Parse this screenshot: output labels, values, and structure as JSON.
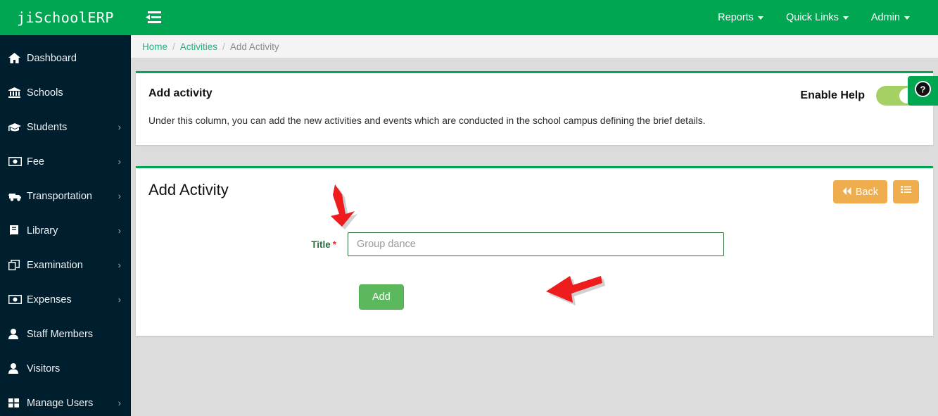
{
  "header": {
    "brand": "jiSchoolERP",
    "sidebar_toggle_icon": "sidebar-collapse-icon",
    "nav": [
      {
        "label": "Reports",
        "icon": "chevron-down-icon"
      },
      {
        "label": "Quick Links",
        "icon": "chevron-down-icon"
      },
      {
        "label": "Admin",
        "icon": "chevron-down-icon"
      }
    ]
  },
  "sidebar": {
    "items": [
      {
        "label": "Dashboard",
        "icon": "home-icon",
        "arrow": ""
      },
      {
        "label": "Schools",
        "icon": "bank-icon",
        "arrow": ""
      },
      {
        "label": "Students",
        "icon": "graduation-cap-icon",
        "arrow": "›"
      },
      {
        "label": "Fee",
        "icon": "money-icon",
        "arrow": "›"
      },
      {
        "label": "Transportation",
        "icon": "bus-icon",
        "arrow": "›"
      },
      {
        "label": "Library",
        "icon": "book-icon",
        "arrow": "›"
      },
      {
        "label": "Examination",
        "icon": "copy-icon",
        "arrow": "›"
      },
      {
        "label": "Expenses",
        "icon": "money-icon",
        "arrow": "›"
      },
      {
        "label": "Staff Members",
        "icon": "user-icon",
        "arrow": ""
      },
      {
        "label": "Visitors",
        "icon": "user-icon",
        "arrow": ""
      },
      {
        "label": "Manage Users",
        "icon": "grid-icon",
        "arrow": "›"
      }
    ]
  },
  "breadcrumb": {
    "home": "Home",
    "sep1": "/",
    "section": "Activities",
    "sep2": "/",
    "current": "Add Activity"
  },
  "help_card": {
    "title": "Add activity",
    "text": "Under this column, you can add the new activities and events which are conducted in the school campus defining the brief details.",
    "toggle_label": "Enable Help",
    "toggle_state": "on"
  },
  "form_card": {
    "title": "Add Activity",
    "back_label": "Back",
    "back_icon": "fast-backward-icon",
    "list_icon": "list-icon",
    "field_label": "Title",
    "required_mark": "*",
    "input_placeholder": "Group dance",
    "input_value": "",
    "submit_label": "Add"
  },
  "help_tab": {
    "icon": "question-circle-icon"
  },
  "annotations": [
    {
      "name": "arrow-to-title-input",
      "direction": "down-right",
      "color": "#ee1c1c"
    },
    {
      "name": "arrow-to-add-button",
      "direction": "left",
      "color": "#ee1c1c"
    }
  ],
  "colors": {
    "brand_green": "#00a651",
    "sidebar_navy": "#001f2e",
    "page_bg": "#dcdcdc",
    "amber": "#f0ad4e",
    "success_green": "#5cb85c",
    "toggle_on": "#a5d063",
    "required_red": "#e13333",
    "arrow_red": "#ee1c1c"
  }
}
